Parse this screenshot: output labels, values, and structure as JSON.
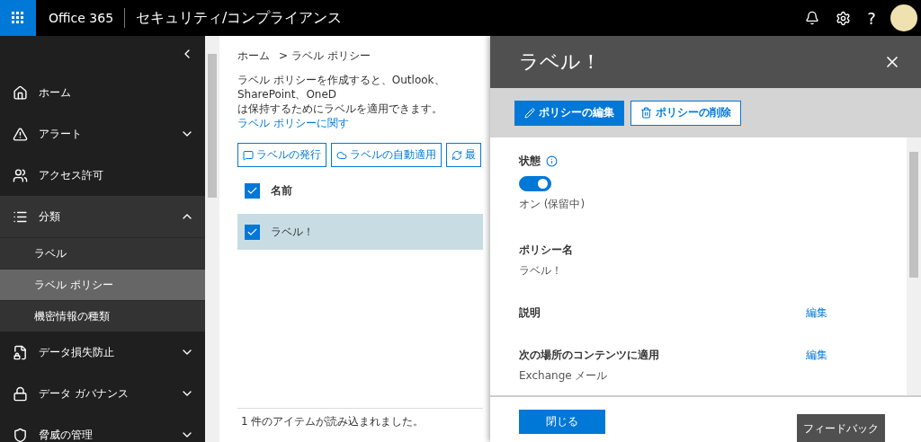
{
  "top_bar": {
    "app_name": "Office 365",
    "title": "セキュリティ/コンプライアンス",
    "help": "?"
  },
  "sidebar": {
    "items": [
      {
        "label": "ホーム",
        "kind": "link"
      },
      {
        "label": "アラート",
        "kind": "group",
        "expanded": false
      },
      {
        "label": "アクセス許可",
        "kind": "link"
      },
      {
        "label": "分類",
        "kind": "group",
        "expanded": true,
        "children": [
          {
            "label": "ラベル",
            "selected": false
          },
          {
            "label": "ラベル ポリシー",
            "selected": true
          },
          {
            "label": "機密情報の種類",
            "selected": false
          }
        ]
      },
      {
        "label": "データ損失防止",
        "kind": "group",
        "expanded": false
      },
      {
        "label": "データ ガバナンス",
        "kind": "group",
        "expanded": false
      },
      {
        "label": "脅威の管理",
        "kind": "group",
        "expanded": false
      }
    ]
  },
  "main": {
    "breadcrumb": [
      "ホーム",
      "> ラベル ポリシー"
    ],
    "description": {
      "line_1": "ラベル ポリシーを作成すると、Outlook、SharePoint、OneD",
      "line_2": "は保持するためにラベルを適用できます。",
      "link": "ラベル ポリシーに関す"
    },
    "toolbar": [
      "ラベルの発行",
      "ラベルの自動適用",
      "最"
    ],
    "table": {
      "all_checked": true,
      "columns": [
        "名前"
      ],
      "rows": [
        {
          "name": "ラベル！",
          "selected": true
        }
      ]
    },
    "status": "1 件のアイテムが読み込まれました。"
  },
  "panel": {
    "title": "ラベル！",
    "actions": [
      {
        "label": "ポリシーの編集",
        "kind": "primary"
      },
      {
        "label": "ポリシーの削除",
        "kind": "secondary"
      }
    ],
    "state": {
      "label": "状態",
      "on": true,
      "text": "オン (保留中)"
    },
    "fields": [
      {
        "label": "ポリシー名",
        "value": "ラベル！"
      },
      {
        "label": "説明",
        "action": "編集"
      },
      {
        "label": "次の場所のコンテンツに適用",
        "action": "編集",
        "value": "Exchange メール"
      }
    ],
    "close": "閉じる",
    "feedback": "フィードバック"
  }
}
